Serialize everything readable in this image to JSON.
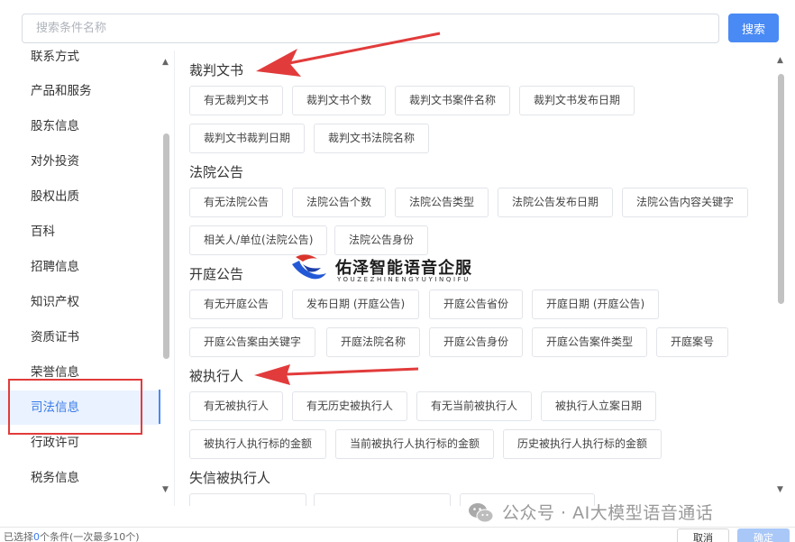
{
  "search": {
    "placeholder": "搜索条件名称",
    "button_label": "搜索"
  },
  "sidebar": {
    "items": [
      {
        "label": "联系方式"
      },
      {
        "label": "产品和服务"
      },
      {
        "label": "股东信息"
      },
      {
        "label": "对外投资"
      },
      {
        "label": "股权出质"
      },
      {
        "label": "百科"
      },
      {
        "label": "招聘信息"
      },
      {
        "label": "知识产权"
      },
      {
        "label": "资质证书"
      },
      {
        "label": "荣誉信息"
      },
      {
        "label": "司法信息",
        "active": true
      },
      {
        "label": "行政许可"
      },
      {
        "label": "税务信息"
      }
    ]
  },
  "sections": [
    {
      "title": "裁判文书",
      "tags": [
        "有无裁判文书",
        "裁判文书个数",
        "裁判文书案件名称",
        "裁判文书发布日期",
        "裁判文书裁判日期",
        "裁判文书法院名称"
      ]
    },
    {
      "title": "法院公告",
      "tags": [
        "有无法院公告",
        "法院公告个数",
        "法院公告类型",
        "法院公告发布日期",
        "法院公告内容关键字",
        "相关人/单位(法院公告)",
        "法院公告身份"
      ]
    },
    {
      "title": "开庭公告",
      "tags": [
        "有无开庭公告",
        "发布日期 (开庭公告)",
        "开庭公告省份",
        "开庭日期 (开庭公告)",
        "开庭公告案由关键字",
        "开庭法院名称",
        "开庭公告身份",
        "开庭公告案件类型",
        "开庭案号"
      ]
    },
    {
      "title": "被执行人",
      "tags": [
        "有无被执行人",
        "有无历史被执行人",
        "有无当前被执行人",
        "被执行人立案日期",
        "被执行人执行标的金额",
        "当前被执行人执行标的金额",
        "历史被执行人执行标的金额"
      ]
    },
    {
      "title": "失信被执行人",
      "tags": []
    }
  ],
  "footer": {
    "prefix": "已选择",
    "count": "0",
    "suffix": "个条件(一次最多10个)",
    "cancel_label": "取消",
    "confirm_label": "确定"
  },
  "watermark": {
    "title": "佑泽智能语音企服",
    "subtitle": "YOUZEZHINENGYUYINQIFU",
    "wechat": "公众号 · AI大模型语音通话"
  },
  "colors": {
    "accent": "#4a8af4",
    "annotation_red": "#e23b3b",
    "active_bg": "#eaf2ff"
  },
  "icons": {
    "wechat": "wechat-icon",
    "scroll_up": "triangle-up-icon",
    "scroll_down": "triangle-down-icon"
  }
}
